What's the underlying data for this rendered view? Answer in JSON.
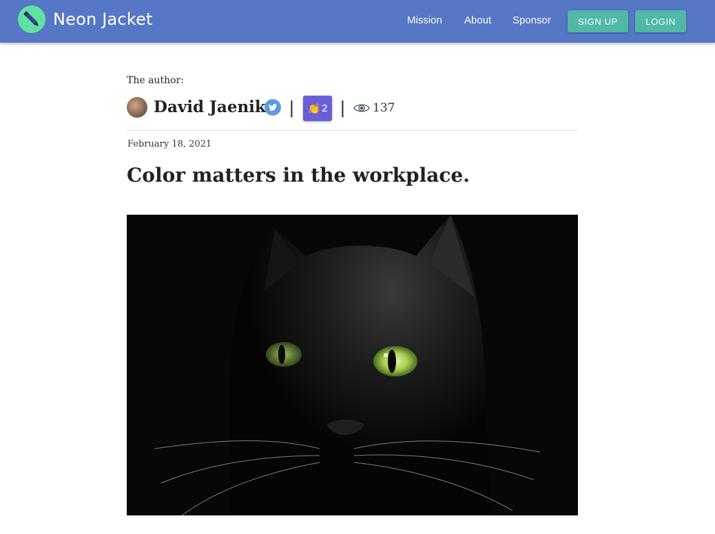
{
  "nav": {
    "brand": "Neon Jacket",
    "links": [
      "Mission",
      "About",
      "Sponsor"
    ],
    "signup_label": "SIGN UP",
    "login_label": "LOGIN"
  },
  "article": {
    "author_caption": "The author:",
    "author_name": "David Jaenike",
    "claps": "2",
    "clap_emoji": "👏",
    "views": "137",
    "separator": "|",
    "date": "February 18, 2021",
    "title": "Color matters in the workplace."
  },
  "icons": {
    "brand_logo": "pen-logo-icon",
    "twitter": "twitter-icon",
    "views": "eye-icon",
    "claps": "clapping-hands-icon"
  },
  "colors": {
    "navbar": "#5577c6",
    "button": "#4fb8a6",
    "logo": "#5de39f",
    "clap_badge": "#6a5fd6",
    "twitter": "#5d9be0"
  }
}
